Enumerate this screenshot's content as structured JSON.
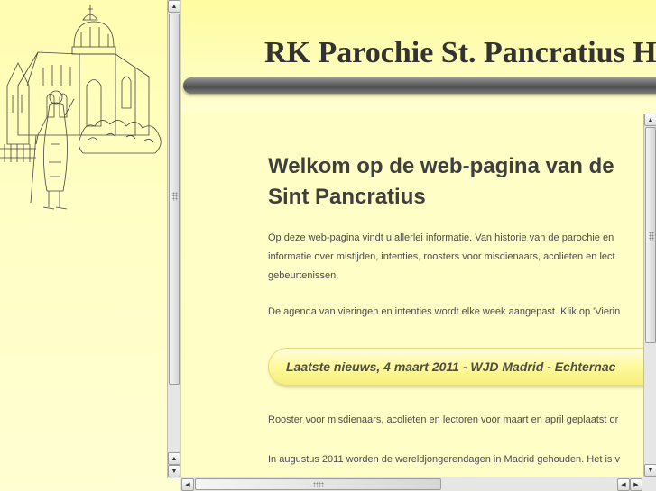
{
  "top": {
    "title": "RK Parochie St. Pancratius Ho"
  },
  "main": {
    "heading_line1": "Welkom op de web-pagina van de",
    "heading_line2": "Sint Pancratius",
    "intro_line1": "Op deze web-pagina vindt u allerlei informatie. Van historie van de parochie en",
    "intro_line2": "informatie over mistijden, intenties, roosters voor misdienaars, acolieten en lect",
    "intro_line3": "gebeurtenissen.",
    "agenda_line": "De agenda van vieringen en intenties wordt elke week aangepast. Klik op 'Vierin",
    "news_title": "Laatste nieuws, 4 maart 2011 - WJD Madrid - Echternac",
    "rooster_line": "Rooster voor misdienaars, acolieten en lectoren voor maart en april geplaatst or",
    "wjd_line": "In augustus 2011 worden de wereldjongerendagen in Madrid gehouden. Het is v"
  },
  "icons": {
    "scroll_up": "arrow-up-icon",
    "scroll_down": "arrow-down-icon",
    "scroll_left": "arrow-left-icon",
    "scroll_right": "arrow-right-icon",
    "artwork": "church-drawing"
  },
  "colors": {
    "background": "#fffec0",
    "title_bar": "#5a5a5a",
    "text": "#4c4c4c",
    "news_box": "#fffaa0"
  }
}
